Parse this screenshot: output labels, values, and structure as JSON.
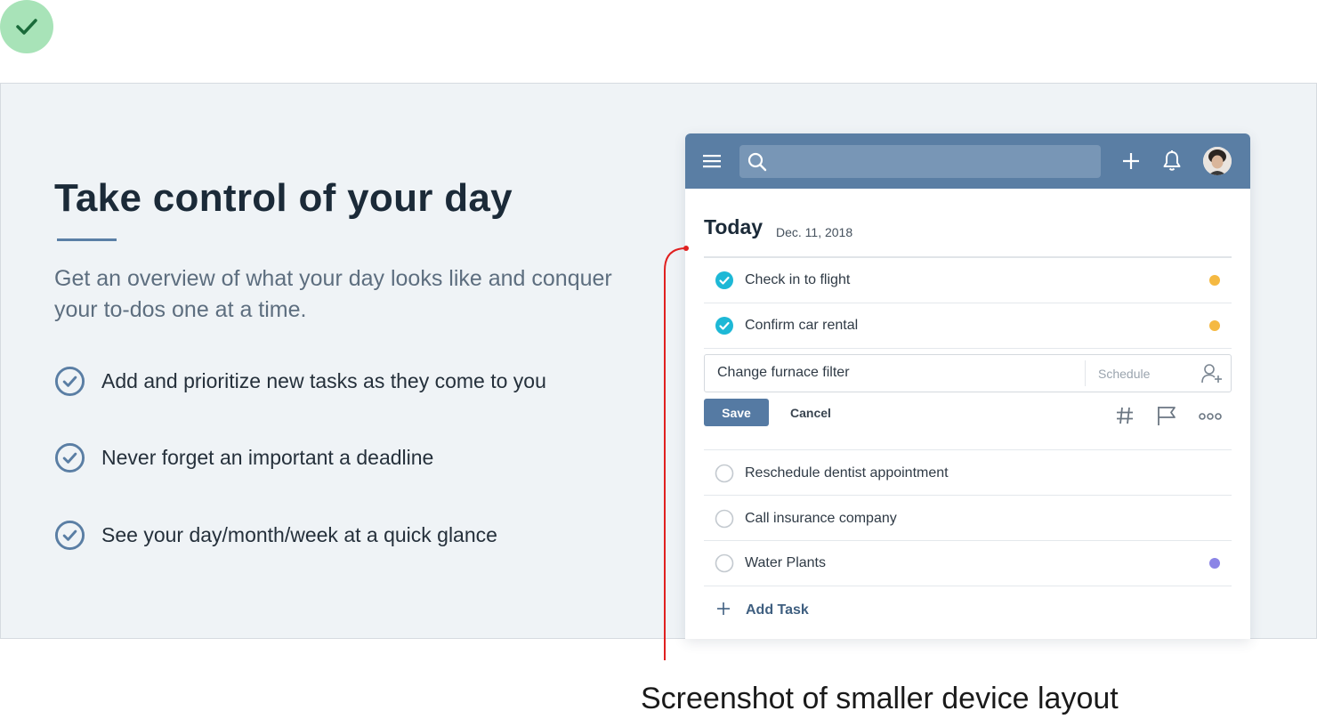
{
  "hero": {
    "title": "Take control of your day",
    "lead": "Get an overview of what your day looks like and conquer your to-dos one at a time.",
    "features": [
      {
        "icon": "check-circle-icon",
        "text": "Add and prioritize new tasks as they come to you"
      },
      {
        "icon": "check-circle-icon",
        "text": "Never forget an important a deadline"
      },
      {
        "icon": "check-circle-icon",
        "text": "See your day/month/week at a quick glance"
      }
    ]
  },
  "device": {
    "header": {
      "search_placeholder": "",
      "icons": [
        "hamburger-menu-icon",
        "search-icon",
        "plus-icon",
        "bell-icon",
        "avatar"
      ]
    },
    "today": {
      "title": "Today",
      "date": "Dec. 11, 2018"
    },
    "tasks_done": [
      {
        "label": "Check in to flight",
        "checked": true,
        "dot_color": "#f5b942"
      },
      {
        "label": "Confirm car rental",
        "checked": true,
        "dot_color": "#f5b942"
      }
    ],
    "editor": {
      "value": "Change furnace filter",
      "schedule_label": "Schedule",
      "save_label": "Save",
      "cancel_label": "Cancel"
    },
    "tasks_open": [
      {
        "label": "Reschedule dentist appointment",
        "checked": false,
        "dot_color": null
      },
      {
        "label": "Call insurance company",
        "checked": false,
        "dot_color": null
      },
      {
        "label": "Water Plants",
        "checked": false,
        "dot_color": "#8b84e6"
      }
    ],
    "add_task_label": "Add Task"
  },
  "annotation": {
    "caption": "Screenshot of smaller device layout"
  },
  "colors": {
    "accent": "#5a7ea4",
    "check_done": "#1db8d6",
    "badge_green": "#a8e3b8",
    "pointer_red": "#e02020"
  }
}
